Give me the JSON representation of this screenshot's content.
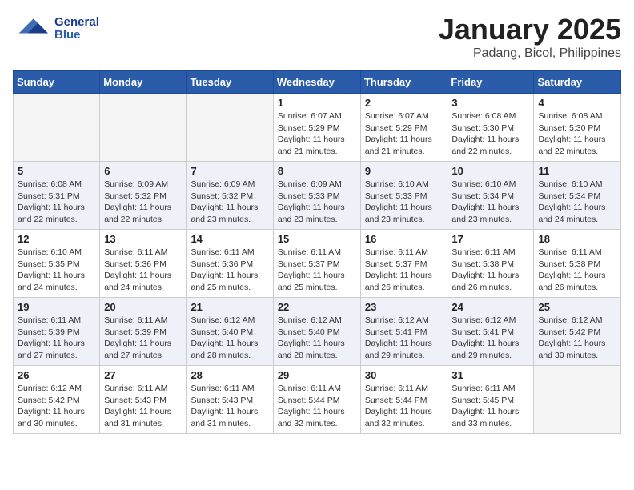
{
  "header": {
    "logo_text_general": "General",
    "logo_text_blue": "Blue",
    "month_year": "January 2025",
    "location": "Padang, Bicol, Philippines"
  },
  "weekdays": [
    "Sunday",
    "Monday",
    "Tuesday",
    "Wednesday",
    "Thursday",
    "Friday",
    "Saturday"
  ],
  "weeks": [
    [
      {
        "day": "",
        "sunrise": "",
        "sunset": "",
        "daylight": ""
      },
      {
        "day": "",
        "sunrise": "",
        "sunset": "",
        "daylight": ""
      },
      {
        "day": "",
        "sunrise": "",
        "sunset": "",
        "daylight": ""
      },
      {
        "day": "1",
        "sunrise": "6:07 AM",
        "sunset": "5:29 PM",
        "daylight": "11 hours and 21 minutes."
      },
      {
        "day": "2",
        "sunrise": "6:07 AM",
        "sunset": "5:29 PM",
        "daylight": "11 hours and 21 minutes."
      },
      {
        "day": "3",
        "sunrise": "6:08 AM",
        "sunset": "5:30 PM",
        "daylight": "11 hours and 22 minutes."
      },
      {
        "day": "4",
        "sunrise": "6:08 AM",
        "sunset": "5:30 PM",
        "daylight": "11 hours and 22 minutes."
      }
    ],
    [
      {
        "day": "5",
        "sunrise": "6:08 AM",
        "sunset": "5:31 PM",
        "daylight": "11 hours and 22 minutes."
      },
      {
        "day": "6",
        "sunrise": "6:09 AM",
        "sunset": "5:32 PM",
        "daylight": "11 hours and 22 minutes."
      },
      {
        "day": "7",
        "sunrise": "6:09 AM",
        "sunset": "5:32 PM",
        "daylight": "11 hours and 23 minutes."
      },
      {
        "day": "8",
        "sunrise": "6:09 AM",
        "sunset": "5:33 PM",
        "daylight": "11 hours and 23 minutes."
      },
      {
        "day": "9",
        "sunrise": "6:10 AM",
        "sunset": "5:33 PM",
        "daylight": "11 hours and 23 minutes."
      },
      {
        "day": "10",
        "sunrise": "6:10 AM",
        "sunset": "5:34 PM",
        "daylight": "11 hours and 23 minutes."
      },
      {
        "day": "11",
        "sunrise": "6:10 AM",
        "sunset": "5:34 PM",
        "daylight": "11 hours and 24 minutes."
      }
    ],
    [
      {
        "day": "12",
        "sunrise": "6:10 AM",
        "sunset": "5:35 PM",
        "daylight": "11 hours and 24 minutes."
      },
      {
        "day": "13",
        "sunrise": "6:11 AM",
        "sunset": "5:36 PM",
        "daylight": "11 hours and 24 minutes."
      },
      {
        "day": "14",
        "sunrise": "6:11 AM",
        "sunset": "5:36 PM",
        "daylight": "11 hours and 25 minutes."
      },
      {
        "day": "15",
        "sunrise": "6:11 AM",
        "sunset": "5:37 PM",
        "daylight": "11 hours and 25 minutes."
      },
      {
        "day": "16",
        "sunrise": "6:11 AM",
        "sunset": "5:37 PM",
        "daylight": "11 hours and 26 minutes."
      },
      {
        "day": "17",
        "sunrise": "6:11 AM",
        "sunset": "5:38 PM",
        "daylight": "11 hours and 26 minutes."
      },
      {
        "day": "18",
        "sunrise": "6:11 AM",
        "sunset": "5:38 PM",
        "daylight": "11 hours and 26 minutes."
      }
    ],
    [
      {
        "day": "19",
        "sunrise": "6:11 AM",
        "sunset": "5:39 PM",
        "daylight": "11 hours and 27 minutes."
      },
      {
        "day": "20",
        "sunrise": "6:11 AM",
        "sunset": "5:39 PM",
        "daylight": "11 hours and 27 minutes."
      },
      {
        "day": "21",
        "sunrise": "6:12 AM",
        "sunset": "5:40 PM",
        "daylight": "11 hours and 28 minutes."
      },
      {
        "day": "22",
        "sunrise": "6:12 AM",
        "sunset": "5:40 PM",
        "daylight": "11 hours and 28 minutes."
      },
      {
        "day": "23",
        "sunrise": "6:12 AM",
        "sunset": "5:41 PM",
        "daylight": "11 hours and 29 minutes."
      },
      {
        "day": "24",
        "sunrise": "6:12 AM",
        "sunset": "5:41 PM",
        "daylight": "11 hours and 29 minutes."
      },
      {
        "day": "25",
        "sunrise": "6:12 AM",
        "sunset": "5:42 PM",
        "daylight": "11 hours and 30 minutes."
      }
    ],
    [
      {
        "day": "26",
        "sunrise": "6:12 AM",
        "sunset": "5:42 PM",
        "daylight": "11 hours and 30 minutes."
      },
      {
        "day": "27",
        "sunrise": "6:11 AM",
        "sunset": "5:43 PM",
        "daylight": "11 hours and 31 minutes."
      },
      {
        "day": "28",
        "sunrise": "6:11 AM",
        "sunset": "5:43 PM",
        "daylight": "11 hours and 31 minutes."
      },
      {
        "day": "29",
        "sunrise": "6:11 AM",
        "sunset": "5:44 PM",
        "daylight": "11 hours and 32 minutes."
      },
      {
        "day": "30",
        "sunrise": "6:11 AM",
        "sunset": "5:44 PM",
        "daylight": "11 hours and 32 minutes."
      },
      {
        "day": "31",
        "sunrise": "6:11 AM",
        "sunset": "5:45 PM",
        "daylight": "11 hours and 33 minutes."
      },
      {
        "day": "",
        "sunrise": "",
        "sunset": "",
        "daylight": ""
      }
    ]
  ],
  "labels": {
    "sunrise_prefix": "Sunrise: ",
    "sunset_prefix": "Sunset: ",
    "daylight_prefix": "Daylight: "
  }
}
